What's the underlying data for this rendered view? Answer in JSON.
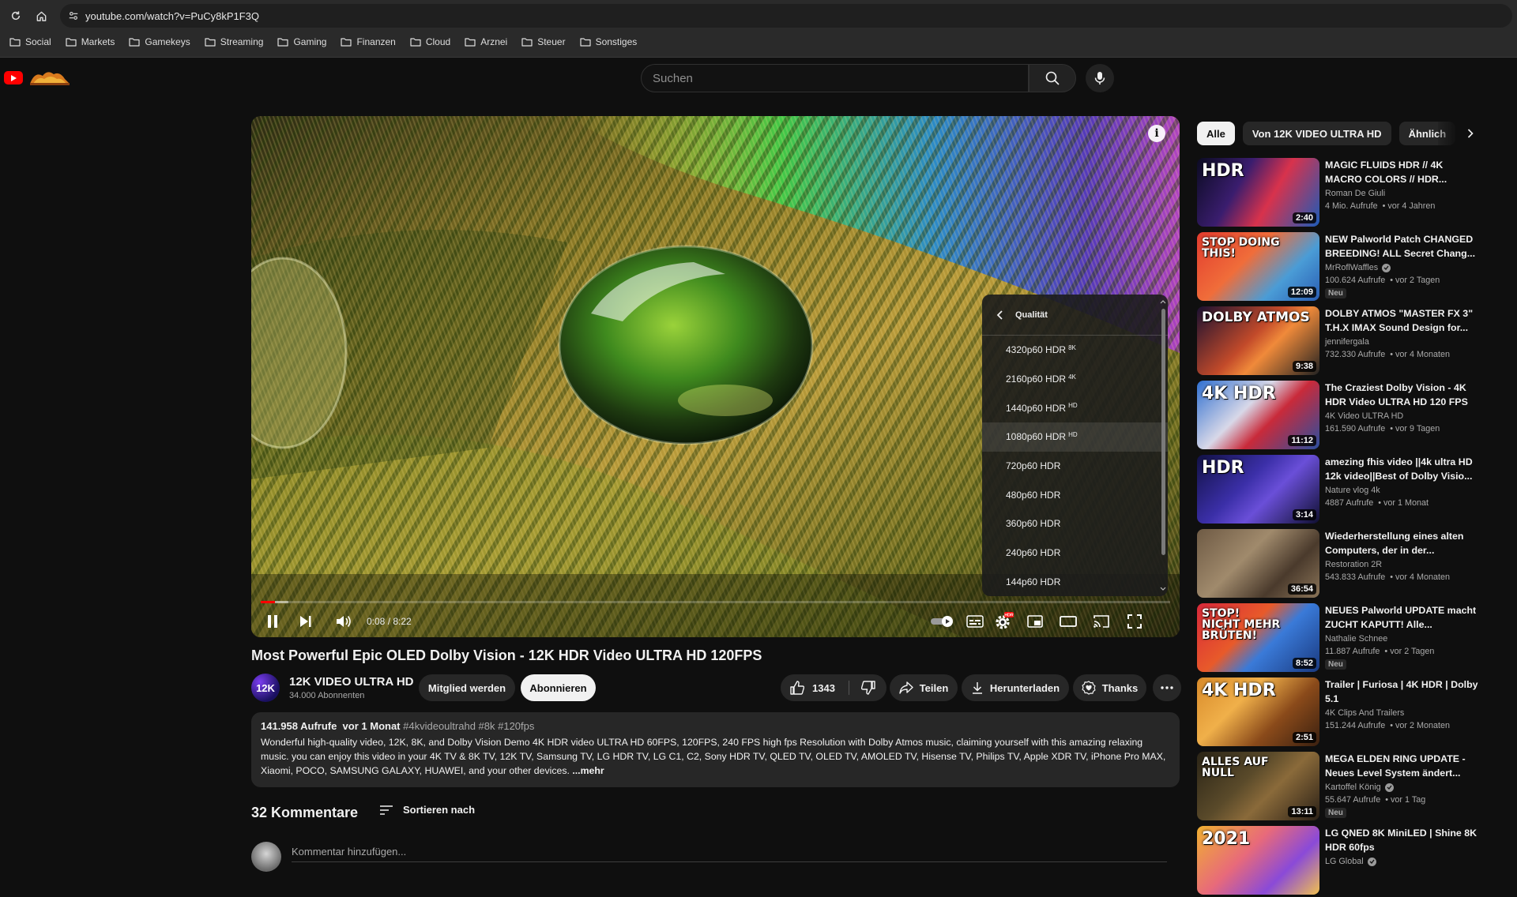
{
  "browser": {
    "url": "youtube.com/watch?v=PuCy8kP1F3Q",
    "bookmarks": [
      "Social",
      "Markets",
      "Gamekeys",
      "Streaming",
      "Gaming",
      "Finanzen",
      "Cloud",
      "Arznei",
      "Steuer",
      "Sonstiges"
    ]
  },
  "header": {
    "search_placeholder": "Suchen"
  },
  "player": {
    "quality_menu": {
      "title": "Qualität",
      "options": [
        {
          "label": "4320p60 HDR",
          "badge": "8K"
        },
        {
          "label": "2160p60 HDR",
          "badge": "4K"
        },
        {
          "label": "1440p60 HDR",
          "badge": "HD"
        },
        {
          "label": "1080p60 HDR",
          "badge": "HD"
        },
        {
          "label": "720p60 HDR",
          "badge": ""
        },
        {
          "label": "480p60 HDR",
          "badge": ""
        },
        {
          "label": "360p60 HDR",
          "badge": ""
        },
        {
          "label": "240p60 HDR",
          "badge": ""
        },
        {
          "label": "144p60 HDR",
          "badge": ""
        }
      ],
      "highlighted_index": 3
    },
    "time": "0:08 / 8:22",
    "progress_played": 0.016,
    "progress_buffered": 0.03,
    "settings_badge": "HDR",
    "accent": "#ff0000"
  },
  "video": {
    "title": "Most Powerful Epic OLED Dolby Vision - 12K HDR Video ULTRA HD 120FPS",
    "channel": {
      "avatar_text": "12K",
      "name": "12K VIDEO ULTRA HD",
      "subscribers": "34.000 Abonnenten"
    },
    "join_label": "Mitglied werden",
    "subscribe_label": "Abonnieren",
    "likes": "1343",
    "share_label": "Teilen",
    "download_label": "Herunterladen",
    "thanks_label": "Thanks"
  },
  "description": {
    "meta": "141.958 Aufrufe  vor 1 Monat",
    "tags": "#4kvideoultrahd #8k #120fps",
    "text": "Wonderful high-quality video, 12K, 8K, and Dolby Vision Demo 4K HDR video ULTRA HD 60FPS, 120FPS, 240 FPS high fps Resolution with Dolby Atmos music, claiming yourself with this amazing relaxing music. you can enjoy this video in your 4K TV & 8K TV, 12K TV, Samsung TV, LG HDR TV, LG C1, C2, Sony HDR TV, QLED TV, OLED TV, AMOLED TV, Hisense TV, Philips TV, Apple XDR TV, iPhone Pro MAX, Xiaomi, POCO, SAMSUNG GALAXY, HUAWEI, and your other devices.",
    "more_label": "...mehr"
  },
  "comments": {
    "count_label": "32 Kommentare",
    "sort_label": "Sortieren nach",
    "add_placeholder": "Kommentar hinzufügen..."
  },
  "sidebar": {
    "chips": [
      "Alle",
      "Von 12K VIDEO ULTRA HD",
      "Ähnlich"
    ],
    "recommendations": [
      {
        "title": "MAGIC FLUIDS HDR // 4K MACRO COLORS // HDR...",
        "channel": "Roman De Giuli",
        "verified": false,
        "stats": "4 Mio. Aufrufe  • vor 4 Jahren",
        "duration": "2:40",
        "new": false,
        "thumb_text": "HDR",
        "thumb_bg": "linear-gradient(120deg,#0b0b22 0%,#3a1d6e 35%,#d8324c 60%,#1c5bb8 100%)"
      },
      {
        "title": "NEW Palworld Patch CHANGED BREEDING! ALL Secret Chang...",
        "channel": "MrRoflWaffles",
        "verified": true,
        "stats": "100.624 Aufrufe  • vor 2 Tagen",
        "duration": "12:09",
        "new": true,
        "thumb_text": "STOP DOING THIS!",
        "thumb_bg": "linear-gradient(135deg,#e23b2e 0%,#f06d3a 40%,#4a9cd6 70%,#2a5db3 100%)"
      },
      {
        "title": "DOLBY ATMOS \"MASTER FX 3\" T.H.X IMAX Sound Design for...",
        "channel": "jennifergala",
        "verified": false,
        "stats": "732.330 Aufrufe  • vor 4 Monaten",
        "duration": "9:38",
        "new": false,
        "thumb_text": "DOLBY ATMOS",
        "thumb_bg": "linear-gradient(135deg,#1a1030 0%,#c24a2a 45%,#f08a3a 60%,#222 100%)"
      },
      {
        "title": "The Craziest Dolby Vision - 4K HDR Video ULTRA HD 120 FPS",
        "channel": "4K Video ULTRA HD",
        "verified": false,
        "stats": "161.590 Aufrufe  • vor 9 Tagen",
        "duration": "11:12",
        "new": false,
        "thumb_text": "4K HDR",
        "thumb_bg": "linear-gradient(135deg,#2f6fd0 0%,#d8d8e8 40%,#c92a3a 60%,#2a4fa0 100%)"
      },
      {
        "title": "amezing fhis video ||4k ultra HD 12k video||Best of Dolby Visio...",
        "channel": "Nature vlog 4k",
        "verified": false,
        "stats": "4887 Aufrufe  • vor 1 Monat",
        "duration": "3:14",
        "new": false,
        "thumb_text": "HDR",
        "thumb_bg": "linear-gradient(135deg,#111144 0%,#3b2fa8 40%,#6a4fd8 60%,#0f0f30 100%)"
      },
      {
        "title": "Wiederherstellung eines alten Computers, der in der...",
        "channel": "Restoration 2R",
        "verified": false,
        "stats": "543.833 Aufrufe  • vor 4 Monaten",
        "duration": "36:54",
        "new": false,
        "thumb_text": "",
        "thumb_bg": "linear-gradient(135deg,#6e5a44 0%,#a08a6c 40%,#4a3a2c 70%,#8a7458 100%)"
      },
      {
        "title": "NEUES Palworld UPDATE macht ZUCHT KAPUTT! Alle...",
        "channel": "Nathalie Schnee",
        "verified": false,
        "stats": "11.887 Aufrufe  • vor 2 Tagen",
        "duration": "8:52",
        "new": true,
        "thumb_text": "STOP! NICHT MEHR BRÜTEN!",
        "thumb_bg": "linear-gradient(135deg,#d8283a 0%,#e85a2a 40%,#3a7ad8 60%,#1a3a80 100%)"
      },
      {
        "title": "Trailer | Furiosa | 4K HDR | Dolby 5.1",
        "channel": "4K Clips And Trailers",
        "verified": false,
        "stats": "151.244 Aufrufe  • vor 2 Monaten",
        "duration": "2:51",
        "new": false,
        "thumb_text": "4K HDR",
        "thumb_bg": "linear-gradient(135deg,#d88a2a 0%,#f0b04a 35%,#8a4a1a 65%,#3a2010 100%)"
      },
      {
        "title": "MEGA ELDEN RING UPDATE - Neues Level System ändert...",
        "channel": "Kartoffel König",
        "verified": true,
        "stats": "55.647 Aufrufe  • vor 1 Tag",
        "duration": "13:11",
        "new": true,
        "thumb_text": "ALLES AUF NULL",
        "thumb_bg": "linear-gradient(135deg,#2a2416 0%,#5a4a2a 40%,#8a6a3a 60%,#2a2016 100%)"
      },
      {
        "title": "LG QNED 8K MiniLED | Shine 8K HDR 60fps",
        "channel": "LG Global",
        "verified": true,
        "stats": "",
        "duration": "",
        "new": false,
        "thumb_text": "2021",
        "thumb_bg": "linear-gradient(135deg,#f0b030 0%,#e86a7a 40%,#8a4ad8 70%,#f0c050 100%)"
      }
    ]
  }
}
